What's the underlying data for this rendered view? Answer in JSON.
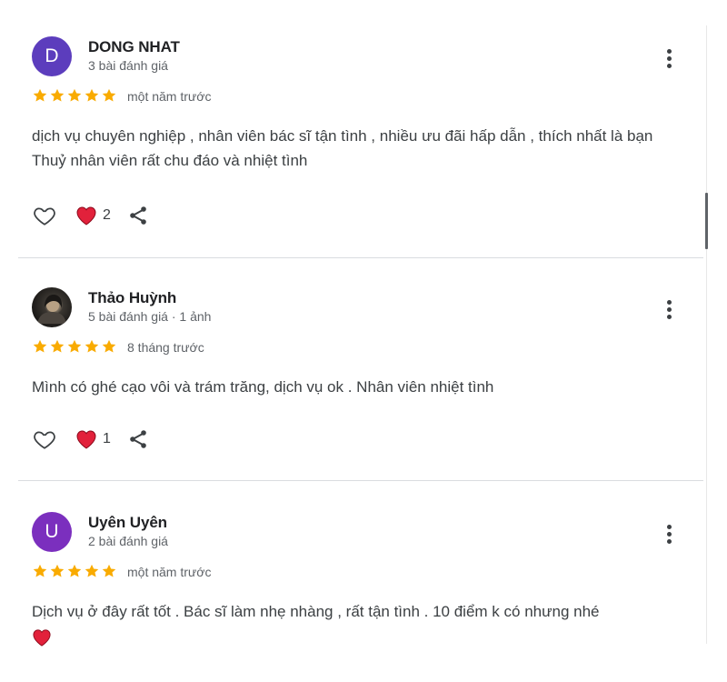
{
  "colors": {
    "star": "#f9ab00",
    "heart": "#e2213b",
    "avatar_d": "#5c3dbd",
    "avatar_u": "#7b2fbe"
  },
  "reviews": [
    {
      "avatar_letter": "D",
      "name": "DONG NHAT",
      "meta": "3 bài đánh giá",
      "rating": 5,
      "time": "một năm trước",
      "text": "dịch vụ chuyên nghiệp , nhân viên bác sĩ tận tình , nhiều ưu đãi hấp dẫn , thích nhất là bạn Thuỷ nhân viên rất chu đáo và nhiệt tình",
      "reaction_count": "2"
    },
    {
      "avatar_letter": "",
      "name": "Thảo Huỳnh",
      "meta": "5 bài đánh giá · 1 ảnh",
      "rating": 5,
      "time": "8 tháng trước",
      "text": "Mình có ghé cạo vôi và trám trăng, dịch vụ ok . Nhân viên nhiệt tình",
      "reaction_count": "1"
    },
    {
      "avatar_letter": "U",
      "name": "Uyên Uyên",
      "meta": "2 bài đánh giá",
      "rating": 5,
      "time": "một năm trước",
      "text": "Dịch vụ ở đây rất tốt . Bác sĩ làm nhẹ nhàng , rất tận tình . 10 điểm k có nhưng nhé",
      "reaction_count": ""
    }
  ],
  "icons": {
    "more": "more-vert-icon",
    "like": "heart-outline-icon",
    "reaction": "heart-filled-icon",
    "share": "share-icon",
    "star": "star-icon"
  }
}
